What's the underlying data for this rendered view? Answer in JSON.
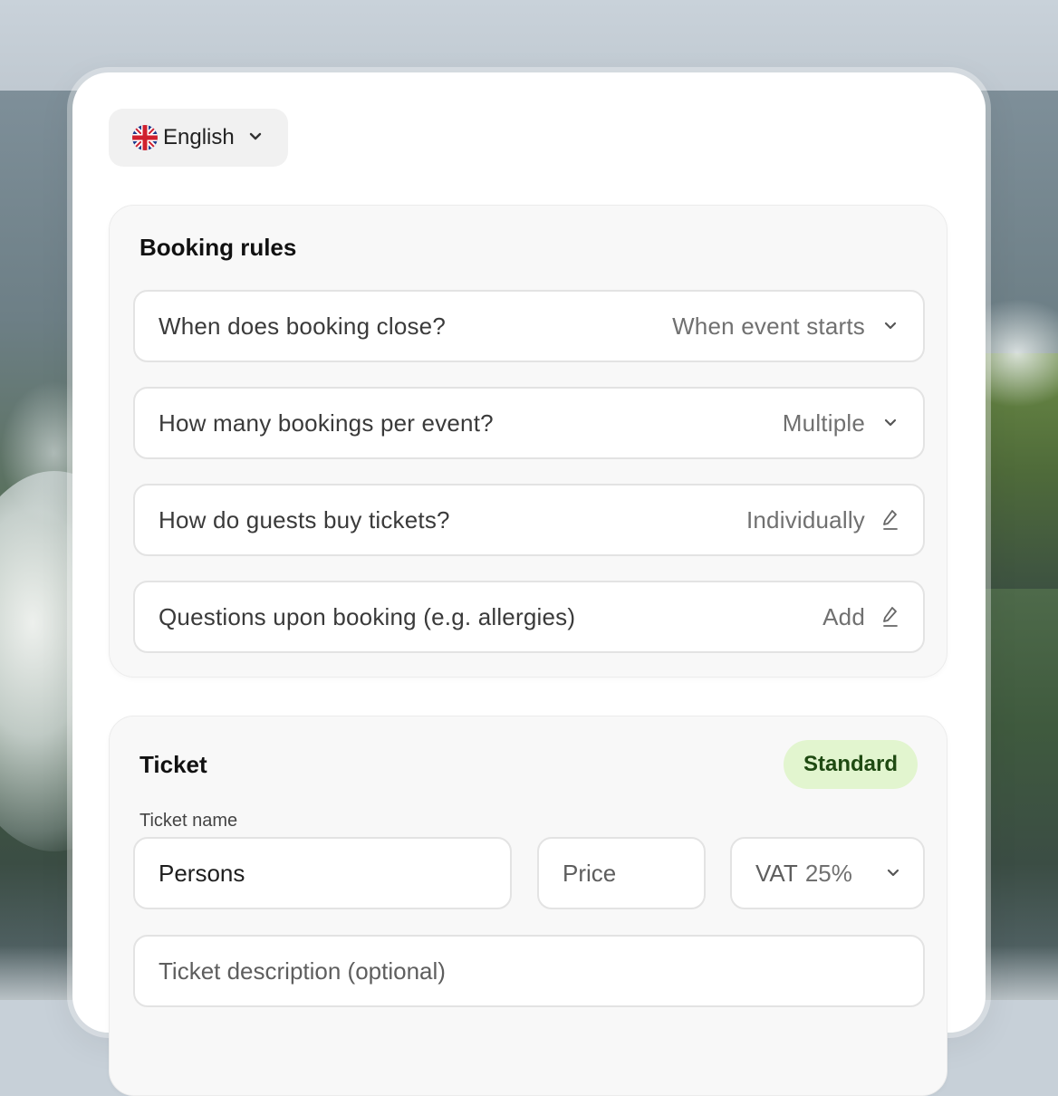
{
  "language": {
    "label": "English",
    "flag_icon": "uk-flag-icon"
  },
  "booking_rules": {
    "title": "Booking rules",
    "rows": [
      {
        "question": "When does booking close?",
        "value": "When event starts",
        "icon": "chevron-down-icon"
      },
      {
        "question": "How many bookings per event?",
        "value": "Multiple",
        "icon": "chevron-down-icon"
      },
      {
        "question": "How do guests buy tickets?",
        "value": "Individually",
        "icon": "pencil-icon"
      },
      {
        "question": "Questions upon booking (e.g. allergies)",
        "value": "Add",
        "icon": "pencil-icon"
      }
    ]
  },
  "ticket": {
    "title": "Ticket",
    "badge": "Standard",
    "name_label": "Ticket name",
    "name_value": "Persons",
    "price_placeholder": "Price",
    "vat_label": "VAT",
    "vat_value": "25%",
    "description_placeholder": "Ticket description (optional)"
  },
  "colors": {
    "badge_bg": "#e2f5cf",
    "badge_text": "#1f4a12",
    "card_bg": "#ffffff",
    "panel_bg": "#f8f8f8"
  }
}
